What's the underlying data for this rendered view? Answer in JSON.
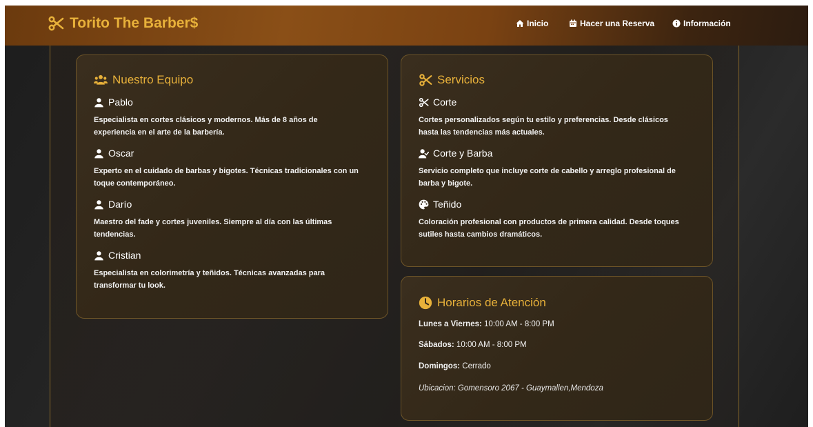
{
  "brand": {
    "name": "Torito The Barber$",
    "icon": "scissors-icon"
  },
  "nav": [
    {
      "label": "Inicio",
      "icon": "home-icon"
    },
    {
      "label": "Hacer una Reserva",
      "icon": "calendar-icon"
    },
    {
      "label": "Información",
      "icon": "info-icon"
    }
  ],
  "team": {
    "title": "Nuestro Equipo",
    "icon": "users-icon",
    "members": [
      {
        "name": "Pablo",
        "desc1": "Especialista en cortes clásicos y modernos. Más de 8 años de",
        "desc2": "experiencia en el arte de la barbería."
      },
      {
        "name": "Oscar",
        "desc1": "Experto en el cuidado de barbas y bigotes. Técnicas tradicionales con un",
        "desc2": "toque contemporáneo."
      },
      {
        "name": "Darío",
        "desc1": "Maestro del fade y cortes juveniles. Siempre al día con las últimas",
        "desc2": "tendencias."
      },
      {
        "name": "Cristian",
        "desc1": "Especialista en colorimetría y teñidos. Técnicas avanzadas para",
        "desc2": "transformar tu look."
      }
    ]
  },
  "services": {
    "title": "Servicios",
    "icon": "scissors-icon",
    "items": [
      {
        "name": "Corte",
        "icon": "scissors-icon",
        "desc1": "Cortes personalizados según tu estilo y preferencias. Desde clásicos",
        "desc2": "hasta las tendencias más actuales."
      },
      {
        "name": "Corte y Barba",
        "icon": "user-check-icon",
        "desc1": "Servicio completo que incluye corte de cabello y arreglo profesional de",
        "desc2": "barba y bigote."
      },
      {
        "name": "Teñido",
        "icon": "palette-icon",
        "desc1": "Coloración profesional con productos de primera calidad. Desde toques",
        "desc2": "sutiles hasta cambios dramáticos."
      }
    ]
  },
  "hours": {
    "title": "Horarios de Atención",
    "icon": "clock-icon",
    "lines": [
      {
        "label": "Lunes a Viernes:",
        "value": " 10:00 AM - 8:00 PM"
      },
      {
        "label": "Sábados:",
        "value": " 10:00 AM - 8:00 PM"
      },
      {
        "label": "Domingos:",
        "value": " Cerrado"
      }
    ],
    "location": "Ubicacion: Gomensoro 2067 - Guaymallen,Mendoza"
  },
  "colors": {
    "accent": "#e8b13a",
    "header": "#8a4f17",
    "card": "#352a1b",
    "border": "#6e5528"
  }
}
